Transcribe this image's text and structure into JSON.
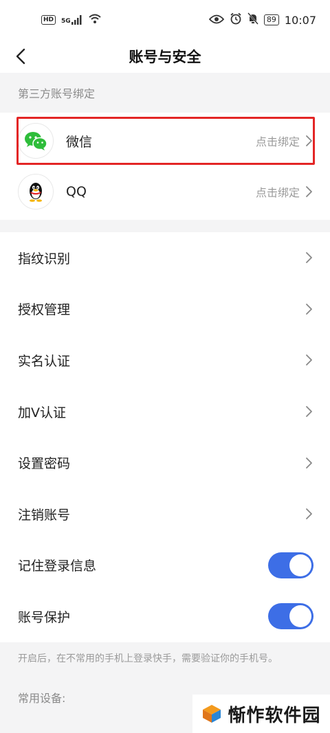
{
  "status_bar": {
    "network_badge": "HD",
    "signal_label": "5G",
    "battery": "89",
    "time": "10:07"
  },
  "nav": {
    "title": "账号与安全"
  },
  "third_party": {
    "section_title": "第三方账号绑定",
    "accounts": [
      {
        "name": "微信",
        "action": "点击绑定",
        "icon": "wechat-icon",
        "color": "#2ebd3a"
      },
      {
        "name": "QQ",
        "action": "点击绑定",
        "icon": "qq-penguin-icon",
        "color": "#111111"
      }
    ]
  },
  "menu": {
    "items": [
      {
        "label": "指纹识别"
      },
      {
        "label": "授权管理"
      },
      {
        "label": "实名认证"
      },
      {
        "label": "加V认证"
      },
      {
        "label": "设置密码"
      },
      {
        "label": "注销账号"
      }
    ],
    "toggles": [
      {
        "label": "记住登录信息",
        "on": true
      },
      {
        "label": "账号保护",
        "on": true
      }
    ],
    "toggle_color": "#3d6ee6"
  },
  "hint": {
    "text": "开启后，在不常用的手机上登录快手，需要验证你的手机号。"
  },
  "devices": {
    "section_title": "常用设备:"
  },
  "watermark": {
    "text": "惭怍软件园"
  }
}
